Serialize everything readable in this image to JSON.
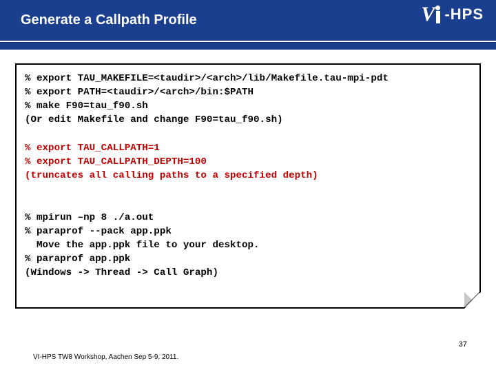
{
  "header": {
    "title": "Generate a Callpath Profile"
  },
  "logo": {
    "v": "V",
    "hps": "-HPS"
  },
  "code": {
    "l1": "% export TAU_MAKEFILE=<taudir>/<arch>/lib/Makefile.tau-mpi-pdt",
    "l2": "% export PATH=<taudir>/<arch>/bin:$PATH",
    "l3": "% make F90=tau_f90.sh",
    "l4": "(Or edit Makefile and change F90=tau_f90.sh)",
    "l5": "",
    "l6": "% export TAU_CALLPATH=1",
    "l7": "% export TAU_CALLPATH_DEPTH=100",
    "l8": "(truncates all calling paths to a specified depth)",
    "l9": "",
    "l10": "",
    "l11": "% mpirun –np 8 ./a.out",
    "l12": "% paraprof --pack app.ppk",
    "l13": "  Move the app.ppk file to your desktop.",
    "l14": "% paraprof app.ppk",
    "l15": "(Windows -> Thread -> Call Graph)"
  },
  "footer": "VI-HPS TW8 Workshop, Aachen Sep 5-9, 2011.",
  "pagenum": "37"
}
